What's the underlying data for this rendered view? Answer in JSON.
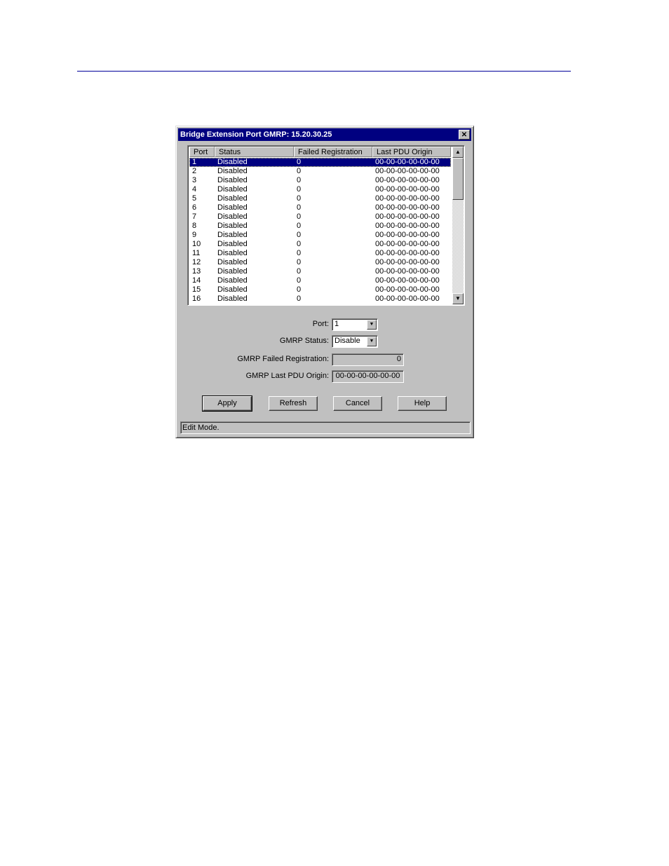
{
  "window": {
    "title": "Bridge Extension Port GMRP: 15.20.30.25",
    "close_label": "✕"
  },
  "table": {
    "columns": [
      "Port",
      "Status",
      "Failed Registration",
      "Last PDU Origin"
    ],
    "selected_index": 0,
    "rows": [
      [
        "1",
        "Disabled",
        "0",
        "00-00-00-00-00-00"
      ],
      [
        "2",
        "Disabled",
        "0",
        "00-00-00-00-00-00"
      ],
      [
        "3",
        "Disabled",
        "0",
        "00-00-00-00-00-00"
      ],
      [
        "4",
        "Disabled",
        "0",
        "00-00-00-00-00-00"
      ],
      [
        "5",
        "Disabled",
        "0",
        "00-00-00-00-00-00"
      ],
      [
        "6",
        "Disabled",
        "0",
        "00-00-00-00-00-00"
      ],
      [
        "7",
        "Disabled",
        "0",
        "00-00-00-00-00-00"
      ],
      [
        "8",
        "Disabled",
        "0",
        "00-00-00-00-00-00"
      ],
      [
        "9",
        "Disabled",
        "0",
        "00-00-00-00-00-00"
      ],
      [
        "10",
        "Disabled",
        "0",
        "00-00-00-00-00-00"
      ],
      [
        "11",
        "Disabled",
        "0",
        "00-00-00-00-00-00"
      ],
      [
        "12",
        "Disabled",
        "0",
        "00-00-00-00-00-00"
      ],
      [
        "13",
        "Disabled",
        "0",
        "00-00-00-00-00-00"
      ],
      [
        "14",
        "Disabled",
        "0",
        "00-00-00-00-00-00"
      ],
      [
        "15",
        "Disabled",
        "0",
        "00-00-00-00-00-00"
      ],
      [
        "16",
        "Disabled",
        "0",
        "00-00-00-00-00-00"
      ]
    ]
  },
  "form": {
    "port_label": "Port:",
    "port_value": "1",
    "status_label": "GMRP Status:",
    "status_value": "Disable",
    "failed_label": "GMRP Failed Registration:",
    "failed_value": "0",
    "origin_label": "GMRP Last PDU Origin:",
    "origin_value": "00-00-00-00-00-00"
  },
  "buttons": {
    "apply": "Apply",
    "refresh": "Refresh",
    "cancel": "Cancel",
    "help": "Help"
  },
  "status_bar": "Edit Mode.",
  "icons": {
    "scroll_up": "▲",
    "scroll_down": "▼",
    "dropdown": "▼"
  }
}
